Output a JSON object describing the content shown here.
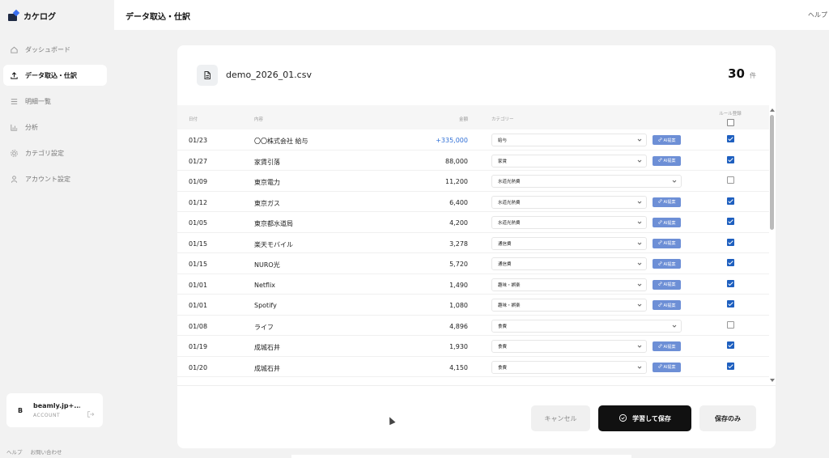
{
  "sidebar": {
    "brand": "カケログ",
    "items": [
      {
        "label": "ダッシュボード",
        "icon": "home-icon"
      },
      {
        "label": "データ取込・仕訳",
        "icon": "upload-icon",
        "active": true
      },
      {
        "label": "明細一覧",
        "icon": "list-icon"
      },
      {
        "label": "分析",
        "icon": "bar-chart-icon"
      },
      {
        "label": "カテゴリ設定",
        "icon": "gear-icon"
      },
      {
        "label": "アカウント設定",
        "icon": "user-icon"
      }
    ],
    "account": {
      "avatar": "B",
      "email": "beamly.jp+...",
      "sub": "ACCOUNT"
    },
    "footer": {
      "help": "ヘルプ",
      "contact": "お問い合わせ"
    }
  },
  "header": {
    "title": "データ取込・仕訳",
    "help": "ヘルプ"
  },
  "card": {
    "file_name": "demo_2026_01.csv",
    "count": "30",
    "count_unit": "件"
  },
  "table": {
    "headers": {
      "date": "日付",
      "desc": "内容",
      "amount": "金額",
      "category": "カテゴリー",
      "rule": "ルール登録"
    },
    "ai_label": "AI提案",
    "rows": [
      {
        "date": "01/23",
        "desc": "〇〇株式会社 給与",
        "amount": "+335,000",
        "income": true,
        "category": "給与",
        "ai": true,
        "checked": true
      },
      {
        "date": "01/27",
        "desc": "家賃引落",
        "amount": "88,000",
        "category": "家賃",
        "ai": true,
        "checked": true
      },
      {
        "date": "01/09",
        "desc": "東京電力",
        "amount": "11,200",
        "category": "水道光熱費",
        "ai": false,
        "checked": false
      },
      {
        "date": "01/12",
        "desc": "東京ガス",
        "amount": "6,400",
        "category": "水道光熱費",
        "ai": true,
        "checked": true
      },
      {
        "date": "01/05",
        "desc": "東京都水道局",
        "amount": "4,200",
        "category": "水道光熱費",
        "ai": true,
        "checked": true
      },
      {
        "date": "01/15",
        "desc": "楽天モバイル",
        "amount": "3,278",
        "category": "通信費",
        "ai": true,
        "checked": true
      },
      {
        "date": "01/15",
        "desc": "NURO光",
        "amount": "5,720",
        "category": "通信費",
        "ai": true,
        "checked": true
      },
      {
        "date": "01/01",
        "desc": "Netflix",
        "amount": "1,490",
        "category": "趣味・娯楽",
        "ai": true,
        "checked": true
      },
      {
        "date": "01/01",
        "desc": "Spotify",
        "amount": "1,080",
        "category": "趣味・娯楽",
        "ai": true,
        "checked": true
      },
      {
        "date": "01/08",
        "desc": "ライフ",
        "amount": "4,896",
        "category": "食費",
        "ai": false,
        "checked": false
      },
      {
        "date": "01/19",
        "desc": "成城石井",
        "amount": "1,930",
        "category": "食費",
        "ai": true,
        "checked": true
      },
      {
        "date": "01/20",
        "desc": "成城石井",
        "amount": "4,150",
        "category": "食費",
        "ai": true,
        "checked": true
      },
      {
        "date": "",
        "desc": "",
        "amount": "",
        "category": "",
        "ai": false,
        "checked": false
      }
    ]
  },
  "actions": {
    "cancel": "キャンセル",
    "learn_save": "学習して保存",
    "save_only": "保存のみ"
  },
  "colors": {
    "accent": "#1e5fbf",
    "income": "#2f6fd6",
    "ai_button": "#6d8fd6",
    "primary_button": "#111111"
  }
}
